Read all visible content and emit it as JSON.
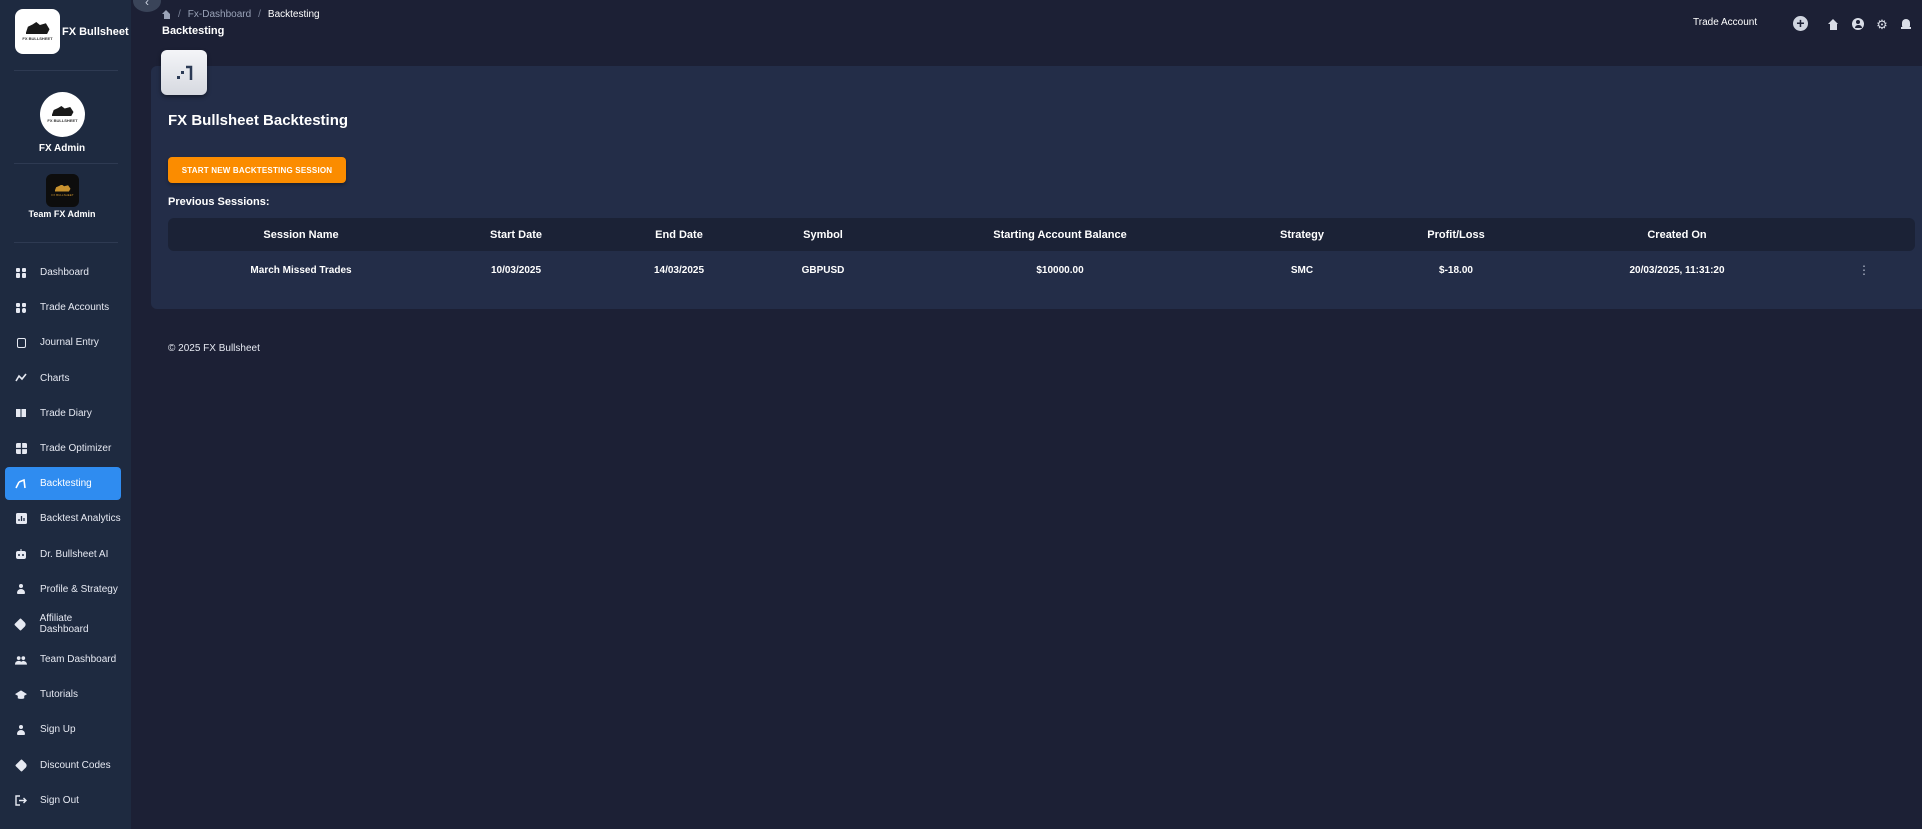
{
  "brand": {
    "name": "FX Bullsheet",
    "logo_text": "FX BULLSHEET"
  },
  "user": {
    "name": "FX Admin",
    "team": "Team FX Admin"
  },
  "sidebar": {
    "items": [
      {
        "label": "Dashboard",
        "icon": "dashboard-icon"
      },
      {
        "label": "Trade Accounts",
        "icon": "trade-accounts-icon"
      },
      {
        "label": "Journal Entry",
        "icon": "journal-icon"
      },
      {
        "label": "Charts",
        "icon": "charts-icon"
      },
      {
        "label": "Trade Diary",
        "icon": "diary-icon"
      },
      {
        "label": "Trade Optimizer",
        "icon": "optimizer-icon"
      },
      {
        "label": "Backtesting",
        "icon": "backtesting-icon",
        "active": true
      },
      {
        "label": "Backtest Analytics",
        "icon": "analytics-icon"
      },
      {
        "label": "Dr. Bullsheet AI",
        "icon": "robot-icon"
      },
      {
        "label": "Profile & Strategy",
        "icon": "person-icon"
      },
      {
        "label": "Affiliate Dashboard",
        "icon": "tag-icon"
      },
      {
        "label": "Team Dashboard",
        "icon": "team-icon"
      },
      {
        "label": "Tutorials",
        "icon": "school-icon"
      },
      {
        "label": "Sign Up",
        "icon": "person-icon"
      },
      {
        "label": "Discount Codes",
        "icon": "tag-icon"
      },
      {
        "label": "Sign Out",
        "icon": "sign-out-icon"
      }
    ]
  },
  "header": {
    "breadcrumb": [
      "Fx-Dashboard",
      "Backtesting"
    ],
    "title": "Backtesting",
    "trade_account_label": "Trade Account",
    "add_symbol": "+"
  },
  "main": {
    "card_title": "FX Bullsheet Backtesting",
    "start_button": "START NEW BACKTESTING SESSION",
    "previous_label": "Previous Sessions:",
    "columns": [
      "Session Name",
      "Start Date",
      "End Date",
      "Symbol",
      "Starting Account Balance",
      "Strategy",
      "Profit/Loss",
      "Created On"
    ],
    "rows": [
      [
        "March Missed Trades",
        "10/03/2025",
        "14/03/2025",
        "GBPUSD",
        "$10000.00",
        "SMC",
        "$-18.00",
        "20/03/2025, 11:31:20"
      ]
    ],
    "more_symbol": "⋮"
  },
  "footer": {
    "text": "© 2025 FX Bullsheet"
  },
  "colors": {
    "background": "#1c2035",
    "sidebar": "#1e2a40",
    "card": "#232d48",
    "active_nav": "#2f8cf0",
    "accent_button": "#fb8c00"
  }
}
